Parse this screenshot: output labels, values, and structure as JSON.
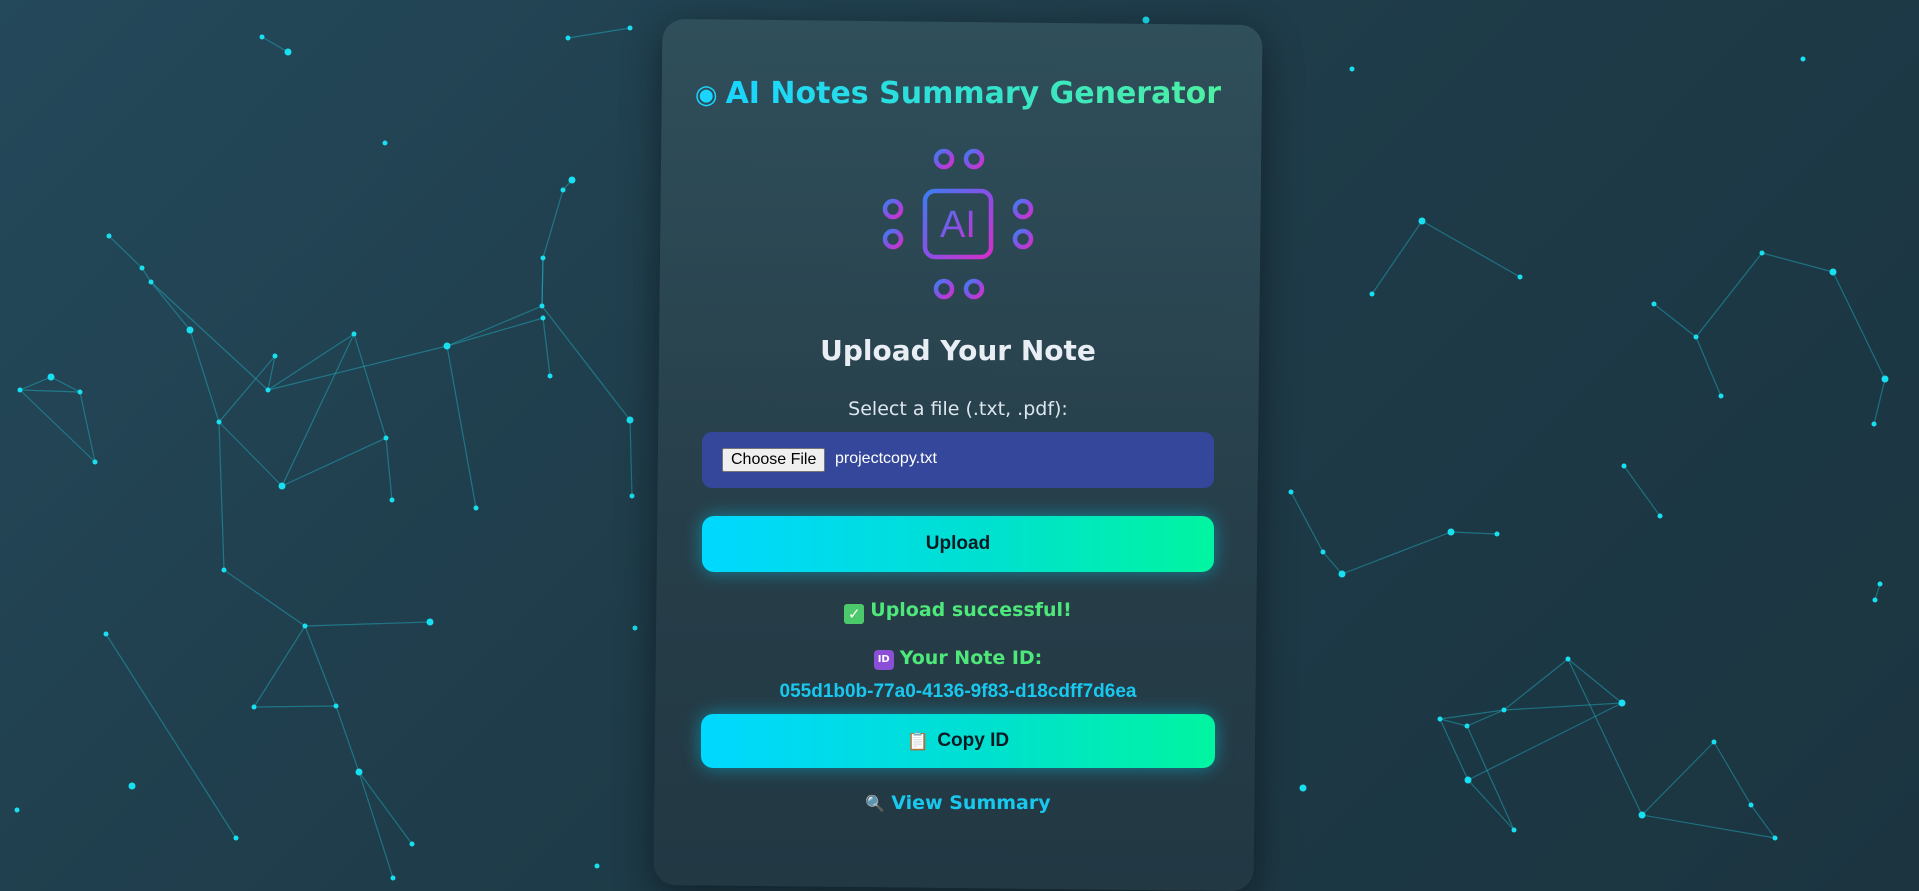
{
  "app": {
    "title": "AI Notes Summary Generator",
    "logo_text": "AI"
  },
  "upload": {
    "heading": "Upload Your Note",
    "file_label": "Select a file (.txt, .pdf):",
    "choose_button": "Choose File",
    "selected_file": "projectcopy.txt",
    "upload_button": "Upload"
  },
  "result": {
    "status": "Upload successful!",
    "note_id_label": "Your Note ID:",
    "note_id_value": "055d1b0b-77a0-4136-9f83-d18cdff7d6ea",
    "copy_button": "Copy ID",
    "view_link": "View Summary"
  },
  "icons": {
    "title": "brain-icon",
    "status": "check-icon",
    "note_id": "id-badge-icon",
    "copy": "clipboard-icon",
    "view": "magnifier-icon"
  },
  "colors": {
    "accent_cyan": "#00d8ff",
    "accent_green": "#00f5a0",
    "success": "#4ee87a",
    "file_box": "#35479b"
  }
}
